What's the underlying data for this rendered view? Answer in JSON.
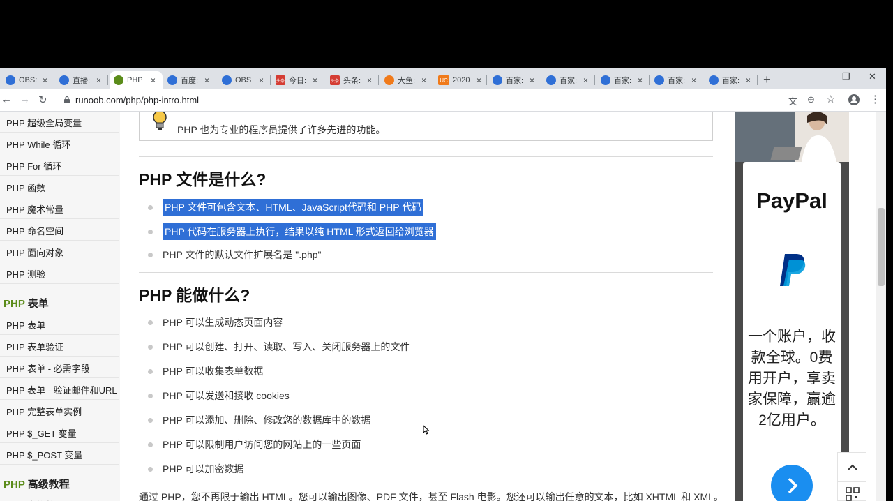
{
  "tabs": [
    {
      "label": "OBS:",
      "favicon": "paw-icon",
      "color": "#2f6fd6"
    },
    {
      "label": "直播:",
      "favicon": "paw-icon",
      "color": "#2f6fd6"
    },
    {
      "label": "PHP",
      "favicon": "runoob-icon",
      "color": "#5b8c1a",
      "active": true
    },
    {
      "label": "百度:",
      "favicon": "paw-icon",
      "color": "#2f6fd6"
    },
    {
      "label": "OBS",
      "favicon": "paw-icon",
      "color": "#2f6fd6"
    },
    {
      "label": "今日:",
      "favicon": "toutiao-icon",
      "color": "#d43c33"
    },
    {
      "label": "头条:",
      "favicon": "toutiao-icon",
      "color": "#d43c33"
    },
    {
      "label": "大鱼:",
      "favicon": "fish-icon",
      "color": "#f07a1a"
    },
    {
      "label": "2020",
      "favicon": "uc-icon",
      "color": "#f07a1a"
    },
    {
      "label": "百家:",
      "favicon": "paw-icon",
      "color": "#2f6fd6"
    },
    {
      "label": "百家:",
      "favicon": "paw-icon",
      "color": "#2f6fd6"
    },
    {
      "label": "百家:",
      "favicon": "paw-icon",
      "color": "#2f6fd6"
    },
    {
      "label": "百家:",
      "favicon": "paw-icon",
      "color": "#2f6fd6"
    },
    {
      "label": "百家:",
      "favicon": "paw-icon",
      "color": "#2f6fd6"
    }
  ],
  "tab_close": "×",
  "favicon_text": {
    "uc": "UC",
    "toutiao": "头条"
  },
  "new_tab": "+",
  "window_controls": {
    "minimize": "—",
    "restore": "❐",
    "close": "✕"
  },
  "toolbar": {
    "back": "←",
    "forward": "→",
    "reload": "↻",
    "url": "runoob.com/php/php-intro.html",
    "icons": [
      "translate-icon",
      "zoom-icon",
      "star-icon",
      "account-icon",
      "menu-icon"
    ],
    "translate": "文",
    "zoom": "⊕",
    "star": "☆",
    "menu": "⋮"
  },
  "sidebar": {
    "items_top": [
      "PHP 超级全局变量",
      "PHP While 循环",
      "PHP For 循环",
      "PHP 函数",
      "PHP 魔术常量",
      "PHP 命名空间",
      "PHP 面向对象",
      "PHP 测验"
    ],
    "section_forms": {
      "prefix": "PHP",
      "title": "表单"
    },
    "items_forms": [
      "PHP 表单",
      "PHP 表单验证",
      "PHP 表单 - 必需字段",
      "PHP 表单 - 验证邮件和URL",
      "PHP 完整表单实例",
      "PHP $_GET 变量",
      "PHP $_POST 变量"
    ],
    "section_advanced": {
      "prefix": "PHP",
      "title": "高级教程"
    },
    "item_partial": "PHP 多维数组"
  },
  "content": {
    "tip_text": "PHP 也为专业的程序员提供了许多先进的功能。",
    "h_what_file": "PHP 文件是什么?",
    "file_items": [
      "PHP 文件可包含文本、HTML、JavaScript代码和 PHP 代码",
      "PHP 代码在服务器上执行，结果以纯 HTML 形式返回给浏览器",
      "PHP 文件的默认文件扩展名是 \".php\""
    ],
    "h_can_do": "PHP 能做什么?",
    "can_items": [
      "PHP 可以生成动态页面内容",
      "PHP 可以创建、打开、读取、写入、关闭服务器上的文件",
      "PHP 可以收集表单数据",
      "PHP 可以发送和接收 cookies",
      "PHP 可以添加、删除、修改您的数据库中的数据",
      "PHP 可以限制用户访问您的网站上的一些页面",
      "PHP 可以加密数据"
    ],
    "paragraph": "通过 PHP，您不再限于输出 HTML。您可以输出图像、PDF 文件，甚至 Flash 电影。您还可以输出任意的文本，比如 XHTML 和 XML。"
  },
  "ad": {
    "brand": "PayPal",
    "slogan": "一个账户，收款全球。0费用开户，享卖家保障，赢逾2亿用户。",
    "cta_icon": "chevron-right-icon"
  },
  "floating": {
    "top_icon": "chevron-up-icon",
    "qr_icon": "qr-code-icon"
  },
  "colors": {
    "accent": "#5b8c1a",
    "highlight": "#2f6fd6",
    "paypal_blue": "#1a8ef0"
  }
}
